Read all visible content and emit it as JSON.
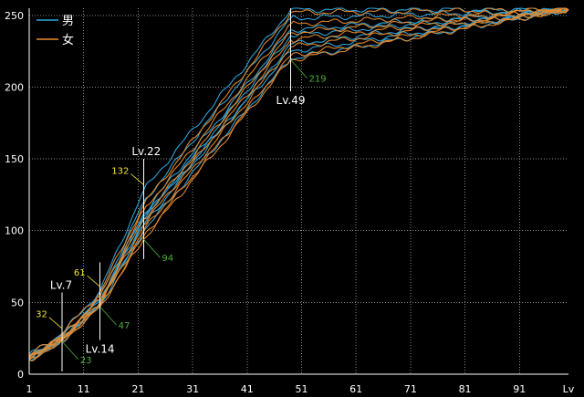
{
  "chart_data": {
    "type": "line",
    "title": "",
    "xlabel": "Lv",
    "ylabel": "",
    "xlim": [
      1,
      100
    ],
    "ylim": [
      0,
      255
    ],
    "x_ticks": [
      1,
      11,
      21,
      31,
      41,
      51,
      61,
      71,
      81,
      91
    ],
    "y_ticks": [
      0,
      50,
      100,
      150,
      200,
      250
    ],
    "grid": true,
    "legend_position": "top-left",
    "legend": [
      {
        "name": "男",
        "color": "#31a9e0"
      },
      {
        "name": "女",
        "color": "#e88a2c"
      }
    ],
    "series": [
      {
        "name": "男",
        "values": [
          [
            1,
            14
          ],
          [
            7,
            28
          ],
          [
            14,
            58
          ],
          [
            22,
            128
          ],
          [
            49,
            254
          ],
          [
            100,
            254
          ]
        ]
      },
      {
        "name": "男",
        "values": [
          [
            1,
            13
          ],
          [
            7,
            26
          ],
          [
            14,
            54
          ],
          [
            22,
            120
          ],
          [
            49,
            248
          ],
          [
            100,
            254
          ]
        ]
      },
      {
        "name": "男",
        "values": [
          [
            1,
            12
          ],
          [
            7,
            25
          ],
          [
            14,
            52
          ],
          [
            22,
            112
          ],
          [
            49,
            240
          ],
          [
            100,
            254
          ]
        ]
      },
      {
        "name": "男",
        "values": [
          [
            1,
            12
          ],
          [
            7,
            24
          ],
          [
            14,
            50
          ],
          [
            22,
            108
          ],
          [
            49,
            236
          ],
          [
            100,
            254
          ]
        ]
      },
      {
        "name": "男",
        "values": [
          [
            1,
            11
          ],
          [
            7,
            23
          ],
          [
            14,
            49
          ],
          [
            22,
            104
          ],
          [
            49,
            230
          ],
          [
            100,
            254
          ]
        ]
      },
      {
        "name": "男",
        "values": [
          [
            1,
            11
          ],
          [
            7,
            24
          ],
          [
            14,
            51
          ],
          [
            22,
            110
          ],
          [
            49,
            225
          ],
          [
            100,
            254
          ]
        ]
      },
      {
        "name": "男",
        "values": [
          [
            1,
            10
          ],
          [
            7,
            23
          ],
          [
            14,
            48
          ],
          [
            22,
            100
          ],
          [
            49,
            220
          ],
          [
            100,
            254
          ]
        ]
      },
      {
        "name": "女",
        "values": [
          [
            1,
            13
          ],
          [
            7,
            28
          ],
          [
            14,
            57
          ],
          [
            22,
            118
          ],
          [
            49,
            252
          ],
          [
            100,
            254
          ]
        ]
      },
      {
        "name": "女",
        "values": [
          [
            1,
            12
          ],
          [
            7,
            26
          ],
          [
            14,
            54
          ],
          [
            22,
            114
          ],
          [
            49,
            244
          ],
          [
            100,
            254
          ]
        ]
      },
      {
        "name": "女",
        "values": [
          [
            1,
            12
          ],
          [
            7,
            25
          ],
          [
            14,
            52
          ],
          [
            22,
            108
          ],
          [
            49,
            238
          ],
          [
            100,
            254
          ]
        ]
      },
      {
        "name": "女",
        "values": [
          [
            1,
            11
          ],
          [
            7,
            24
          ],
          [
            14,
            50
          ],
          [
            22,
            104
          ],
          [
            49,
            233
          ],
          [
            100,
            254
          ]
        ]
      },
      {
        "name": "女",
        "values": [
          [
            1,
            11
          ],
          [
            7,
            24
          ],
          [
            14,
            49
          ],
          [
            22,
            100
          ],
          [
            49,
            228
          ],
          [
            100,
            254
          ]
        ]
      },
      {
        "name": "女",
        "values": [
          [
            1,
            10
          ],
          [
            7,
            23
          ],
          [
            14,
            47
          ],
          [
            22,
            96
          ],
          [
            49,
            222
          ],
          [
            100,
            254
          ]
        ]
      },
      {
        "name": "女",
        "values": [
          [
            1,
            10
          ],
          [
            7,
            23
          ],
          [
            14,
            47
          ],
          [
            22,
            94
          ],
          [
            49,
            219
          ],
          [
            100,
            254
          ]
        ]
      }
    ],
    "level_markers": [
      {
        "x": 7,
        "label": "Lv.7",
        "top": 57,
        "bottom": 2,
        "label_at": "top"
      },
      {
        "x": 14,
        "label": "Lv.14",
        "top": 78,
        "bottom": 24,
        "label_at": "bottom"
      },
      {
        "x": 22,
        "label": "Lv.22",
        "top": 150,
        "bottom": 80,
        "label_at": "top"
      },
      {
        "x": 49,
        "label": "Lv.49",
        "top": 255,
        "bottom": 197,
        "label_at": "bottom"
      }
    ],
    "annotations": [
      {
        "x": 7,
        "y": 32,
        "text": "32",
        "kind": "max"
      },
      {
        "x": 7,
        "y": 23,
        "text": "23",
        "kind": "min"
      },
      {
        "x": 14,
        "y": 61,
        "text": "61",
        "kind": "max"
      },
      {
        "x": 14,
        "y": 47,
        "text": "47",
        "kind": "min"
      },
      {
        "x": 22,
        "y": 132,
        "text": "132",
        "kind": "max"
      },
      {
        "x": 22,
        "y": 94,
        "text": "94",
        "kind": "min"
      },
      {
        "x": 49,
        "y": 219,
        "text": "219",
        "kind": "min"
      }
    ],
    "colors": {
      "background": "#000000",
      "grid": "#8a8a8a",
      "text": "#ffffff",
      "max_label": "#f2e33a",
      "min_label": "#4caf3a",
      "marker": "#ffffff"
    }
  }
}
